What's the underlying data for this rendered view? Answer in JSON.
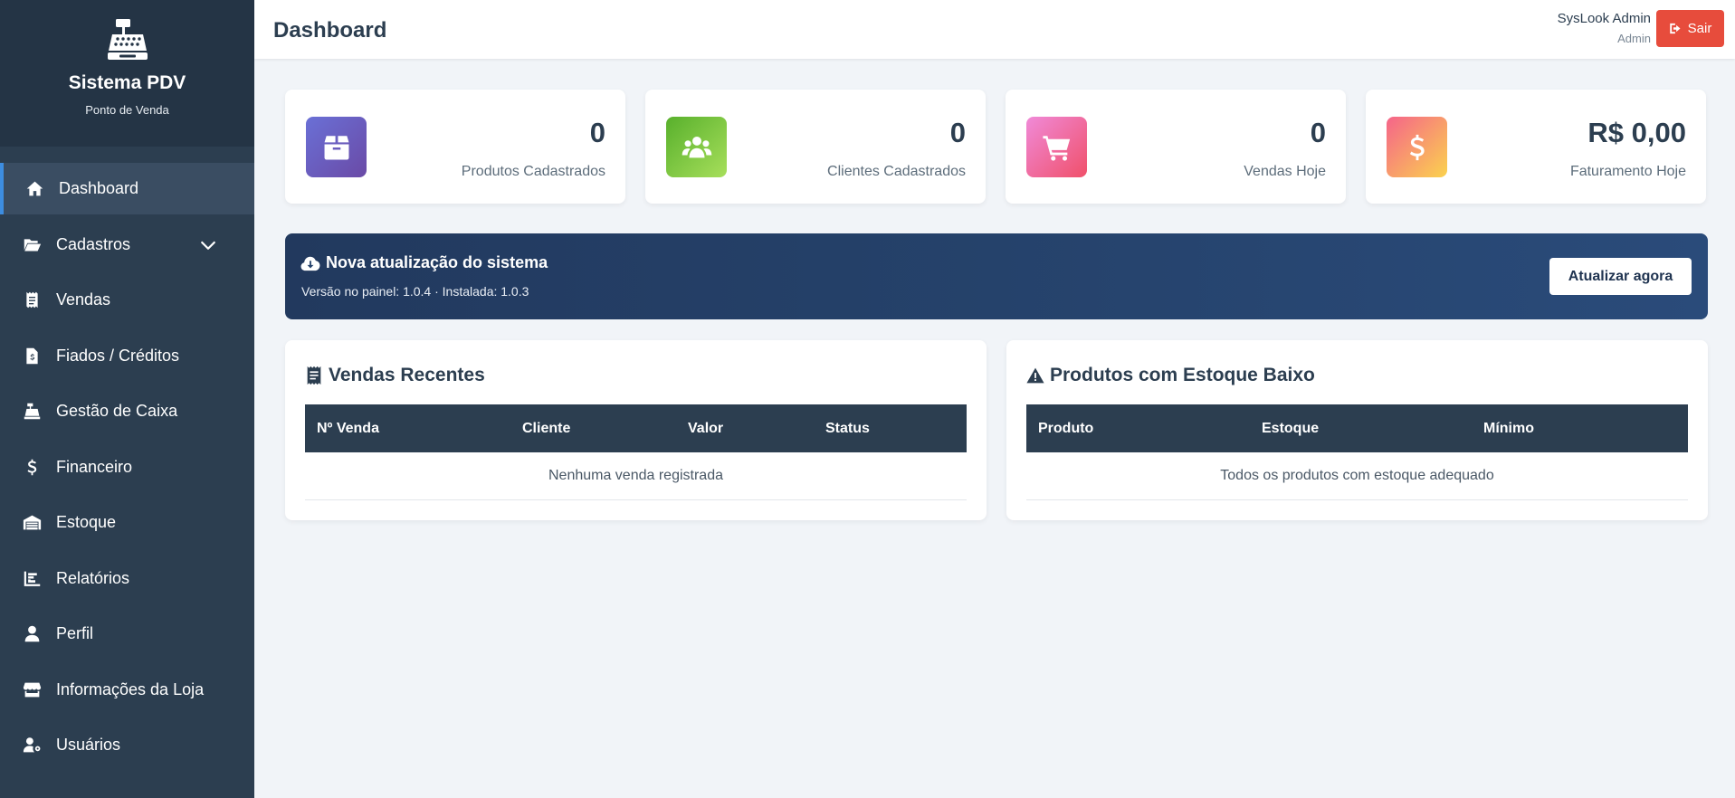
{
  "sidebar": {
    "title": "Sistema PDV",
    "subtitle": "Ponto de Venda",
    "items": [
      {
        "label": "Dashboard",
        "icon": "home-icon",
        "active": true
      },
      {
        "label": "Cadastros",
        "icon": "folder-open-icon",
        "has_submenu": true
      },
      {
        "label": "Vendas",
        "icon": "receipt-icon"
      },
      {
        "label": "Fiados / Créditos",
        "icon": "invoice-dollar-icon"
      },
      {
        "label": "Gestão de Caixa",
        "icon": "cash-register-icon"
      },
      {
        "label": "Financeiro",
        "icon": "dollar-icon"
      },
      {
        "label": "Estoque",
        "icon": "warehouse-icon"
      },
      {
        "label": "Relatórios",
        "icon": "chart-bar-icon"
      },
      {
        "label": "Perfil",
        "icon": "user-icon"
      },
      {
        "label": "Informações da Loja",
        "icon": "store-icon"
      },
      {
        "label": "Usuários",
        "icon": "user-gear-icon"
      }
    ]
  },
  "header": {
    "title": "Dashboard",
    "user_name": "SysLook Admin",
    "user_role": "Admin",
    "logout_label": "Sair"
  },
  "stats": [
    {
      "value": "0",
      "label": "Produtos Cadastrados",
      "icon": "box-icon"
    },
    {
      "value": "0",
      "label": "Clientes Cadastrados",
      "icon": "users-icon"
    },
    {
      "value": "0",
      "label": "Vendas Hoje",
      "icon": "cart-icon"
    },
    {
      "value": "R$ 0,00",
      "label": "Faturamento Hoje",
      "icon": "dollar-icon"
    }
  ],
  "update": {
    "title": "Nova atualização do sistema",
    "subtitle": "Versão no painel: 1.0.4 · Instalada: 1.0.3",
    "button": "Atualizar agora"
  },
  "recent_sales": {
    "title": "Vendas Recentes",
    "columns": [
      "Nº Venda",
      "Cliente",
      "Valor",
      "Status"
    ],
    "empty": "Nenhuma venda registrada"
  },
  "low_stock": {
    "title": "Produtos com Estoque Baixo",
    "columns": [
      "Produto",
      "Estoque",
      "Mínimo"
    ],
    "empty": "Todos os produtos com estoque adequado"
  },
  "colors": {
    "sidebar": "#2c3e50",
    "accent": "#3d8de0",
    "danger": "#e74c3c",
    "banner": "#25426b"
  }
}
